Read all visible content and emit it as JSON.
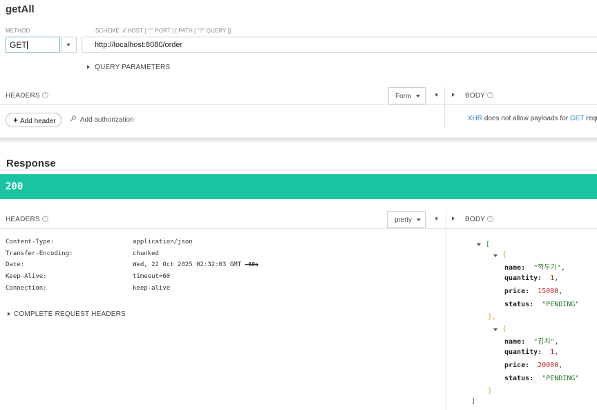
{
  "request": {
    "title": "getAll",
    "method_label": "METHOD",
    "method_value": "GET",
    "scheme_label": "SCHEME :// HOST [ \":\" PORT ] [ PATH [ \"?\" QUERY ]]",
    "url": "http://localhost:8080/order",
    "query_params_label": "QUERY PARAMETERS",
    "headers_label": "HEADERS",
    "format_select": "Form",
    "body_label": "BODY",
    "add_header_label": "Add header",
    "add_authorization_label": "Add authorization",
    "body_note": {
      "xhr": "XHR",
      "middle": " does not allow payloads for ",
      "get": "GET",
      "rest": " request"
    }
  },
  "response": {
    "title": "Response",
    "status_code": "200",
    "status_color": "#1ac4a3",
    "headers_label": "HEADERS",
    "format_select": "pretty",
    "body_label": "BODY",
    "headers": [
      {
        "name": "Content-Type:",
        "value": "application/json"
      },
      {
        "name": "Transfer-Encoding:",
        "value": "chunked"
      },
      {
        "name": "Date:",
        "value": "Wed, 22 Oct 2025 02:32:03 GMT",
        "extra": "-60s"
      },
      {
        "name": "Keep-Alive:",
        "value": "timeout=60"
      },
      {
        "name": "Connection:",
        "value": "keep-alive"
      }
    ],
    "complete_headers_label": "COMPLETE REQUEST HEADERS",
    "body_json": {
      "open_array": "[",
      "close_array": "]",
      "items": [
        {
          "name": "\"깍두기\"",
          "quantity": "1",
          "price": "15000",
          "status": "\"PENDING\""
        },
        {
          "name": "\"김치\"",
          "quantity": "1",
          "price": "20000",
          "status": "\"PENDING\""
        }
      ],
      "keys": {
        "name": "name:",
        "quantity": "quantity:",
        "price": "price:",
        "status": "status:"
      }
    }
  }
}
